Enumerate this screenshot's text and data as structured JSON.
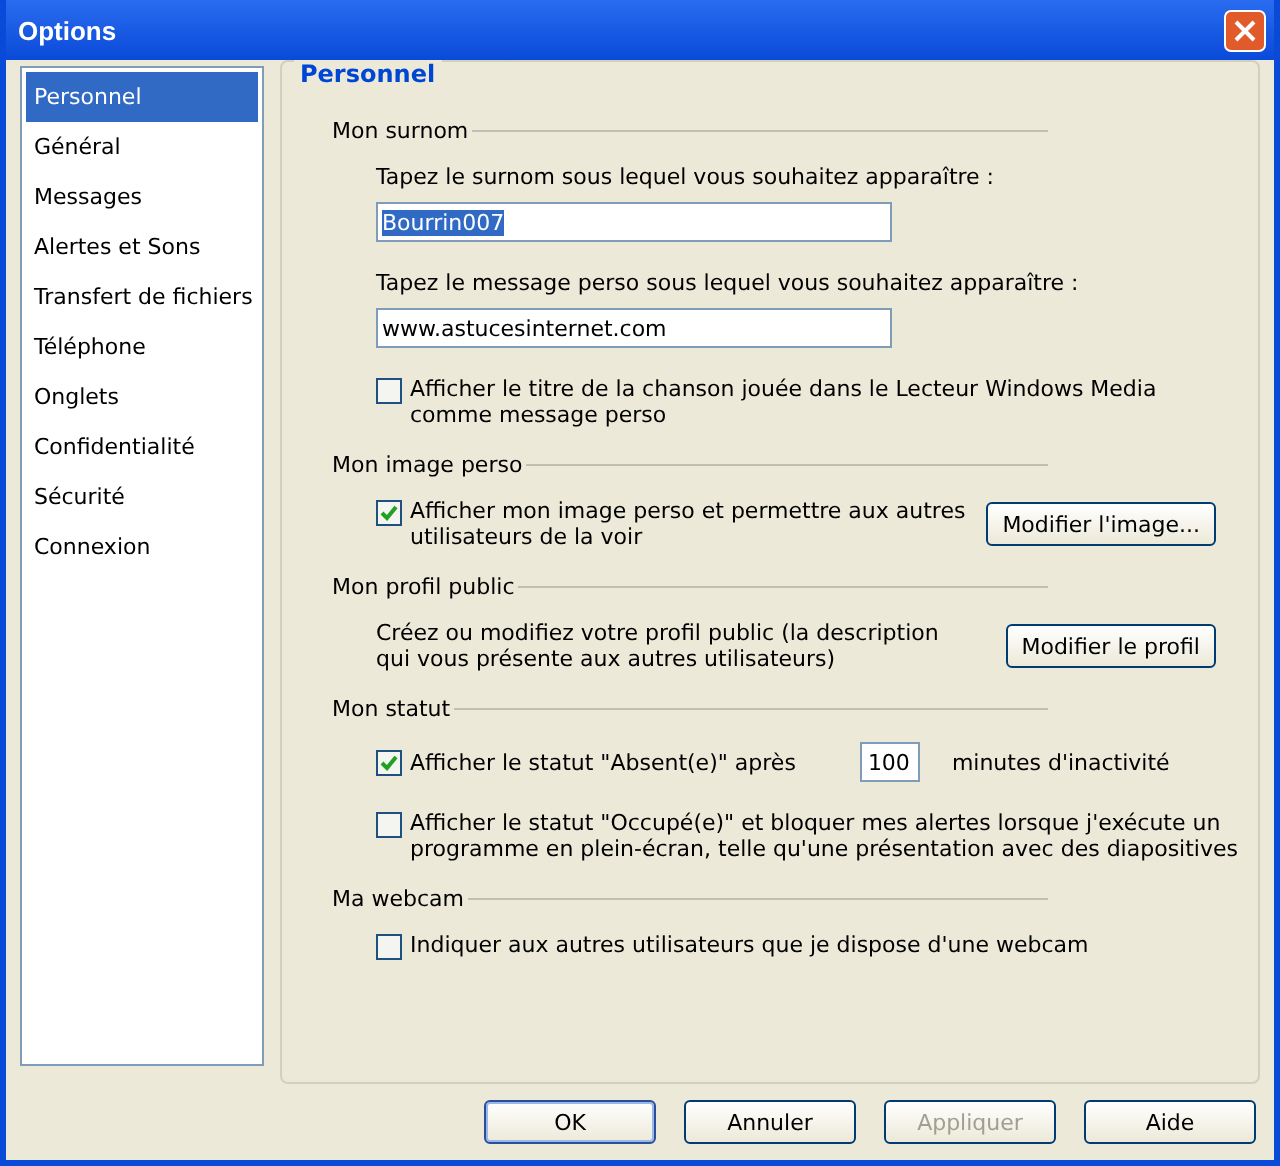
{
  "window": {
    "title": "Options"
  },
  "sidebar": {
    "items": [
      {
        "label": "Personnel",
        "selected": true
      },
      {
        "label": "Général",
        "selected": false
      },
      {
        "label": "Messages",
        "selected": false
      },
      {
        "label": "Alertes et Sons",
        "selected": false
      },
      {
        "label": "Transfert de fichiers",
        "selected": false
      },
      {
        "label": "Téléphone",
        "selected": false
      },
      {
        "label": "Onglets",
        "selected": false
      },
      {
        "label": "Confidentialité",
        "selected": false
      },
      {
        "label": "Sécurité",
        "selected": false
      },
      {
        "label": "Connexion",
        "selected": false
      }
    ]
  },
  "panel": {
    "title": "Personnel",
    "sections": [
      {
        "title": "Mon surnom",
        "items": [
          {
            "kind": "label",
            "text": "Tapez le surnom sous lequel vous souhaitez apparaître :"
          },
          {
            "kind": "field",
            "value": "Bourrin007",
            "selected": true
          },
          {
            "kind": "label",
            "text": "Tapez le message perso sous lequel vous souhaitez apparaître :"
          },
          {
            "kind": "field",
            "value": "www.astucesinternet.com",
            "selected": false
          },
          {
            "kind": "checkbox",
            "label": "Afficher le titre de la chanson jouée dans le Lecteur Windows Media comme message perso",
            "checked": false
          }
        ]
      },
      {
        "title": "Mon image perso",
        "items": [
          {
            "kind": "checkbox",
            "label": "Afficher mon image perso et permettre aux autres utilisateurs de la voir",
            "checked": true,
            "button": "Modifier l'image..."
          }
        ]
      },
      {
        "title": "Mon profil public",
        "items": [
          {
            "kind": "text",
            "text": "Créez ou modifiez votre profil public (la description qui vous présente aux autres utilisateurs)",
            "button": "Modifier le profil"
          }
        ]
      },
      {
        "title": "Mon statut",
        "items": [
          {
            "kind": "idle",
            "label": "Afficher le statut \"Absent(e)\" après",
            "checked": true,
            "value": "100",
            "suffix": "minutes d'inactivité"
          },
          {
            "kind": "checkbox",
            "label": "Afficher le statut \"Occupé(e)\" et bloquer mes alertes lorsque j'exécute un programme en plein-écran, telle qu'une présentation avec des diapositives",
            "checked": false
          }
        ]
      },
      {
        "title": "Ma webcam",
        "items": [
          {
            "kind": "checkbox",
            "label": "Indiquer aux autres utilisateurs que je dispose d'une webcam",
            "checked": false
          }
        ]
      }
    ]
  },
  "buttons": [
    {
      "label": "OK",
      "default": true,
      "disabled": false
    },
    {
      "label": "Annuler",
      "default": false,
      "disabled": false
    },
    {
      "label": "Appliquer",
      "default": false,
      "disabled": true
    },
    {
      "label": "Aide",
      "default": false,
      "disabled": false
    }
  ]
}
